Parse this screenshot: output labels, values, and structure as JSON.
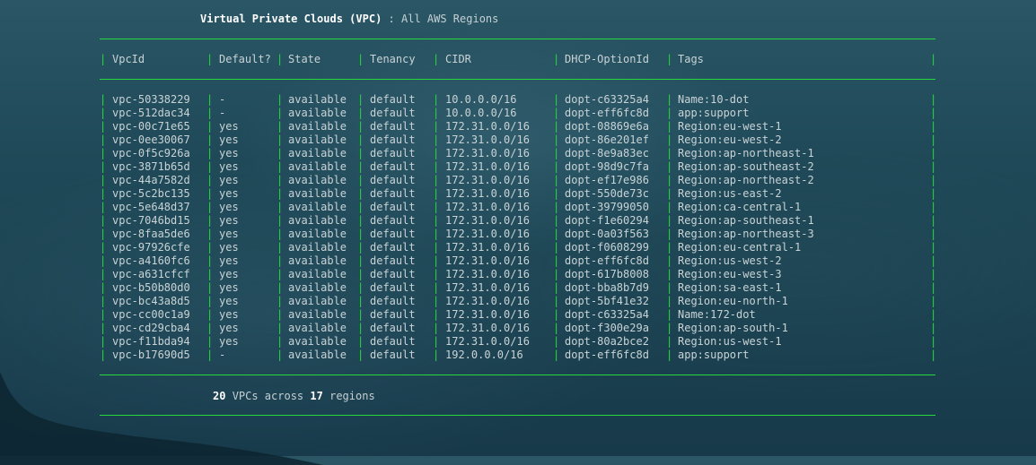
{
  "header": {
    "title": "Virtual Private Clouds (VPC)",
    "separator": ":",
    "subtitle": "All AWS Regions"
  },
  "colors": {
    "border": "#27d83b",
    "text": "#c9d3d6",
    "background": "#1f4958"
  },
  "table": {
    "columns": [
      "VpcId",
      "Default?",
      "State",
      "Tenancy",
      "CIDR",
      "DHCP-OptionId",
      "Tags"
    ],
    "rows": [
      [
        "vpc-50338229",
        "-",
        "available",
        "default",
        "10.0.0.0/16",
        "dopt-c63325a4",
        "Name:10-dot"
      ],
      [
        "vpc-512dac34",
        "-",
        "available",
        "default",
        "10.0.0.0/16",
        "dopt-eff6fc8d",
        "app:support"
      ],
      [
        "vpc-00c71e65",
        "yes",
        "available",
        "default",
        "172.31.0.0/16",
        "dopt-08869e6a",
        "Region:eu-west-1"
      ],
      [
        "vpc-0ee30067",
        "yes",
        "available",
        "default",
        "172.31.0.0/16",
        "dopt-86e201ef",
        "Region:eu-west-2"
      ],
      [
        "vpc-0f5c926a",
        "yes",
        "available",
        "default",
        "172.31.0.0/16",
        "dopt-8e9a83ec",
        "Region:ap-northeast-1"
      ],
      [
        "vpc-3871b65d",
        "yes",
        "available",
        "default",
        "172.31.0.0/16",
        "dopt-98d9c7fa",
        "Region:ap-southeast-2"
      ],
      [
        "vpc-44a7582d",
        "yes",
        "available",
        "default",
        "172.31.0.0/16",
        "dopt-ef17e986",
        "Region:ap-northeast-2"
      ],
      [
        "vpc-5c2bc135",
        "yes",
        "available",
        "default",
        "172.31.0.0/16",
        "dopt-550de73c",
        "Region:us-east-2"
      ],
      [
        "vpc-5e648d37",
        "yes",
        "available",
        "default",
        "172.31.0.0/16",
        "dopt-39799050",
        "Region:ca-central-1"
      ],
      [
        "vpc-7046bd15",
        "yes",
        "available",
        "default",
        "172.31.0.0/16",
        "dopt-f1e60294",
        "Region:ap-southeast-1"
      ],
      [
        "vpc-8faa5de6",
        "yes",
        "available",
        "default",
        "172.31.0.0/16",
        "dopt-0a03f563",
        "Region:ap-northeast-3"
      ],
      [
        "vpc-97926cfe",
        "yes",
        "available",
        "default",
        "172.31.0.0/16",
        "dopt-f0608299",
        "Region:eu-central-1"
      ],
      [
        "vpc-a4160fc6",
        "yes",
        "available",
        "default",
        "172.31.0.0/16",
        "dopt-eff6fc8d",
        "Region:us-west-2"
      ],
      [
        "vpc-a631cfcf",
        "yes",
        "available",
        "default",
        "172.31.0.0/16",
        "dopt-617b8008",
        "Region:eu-west-3"
      ],
      [
        "vpc-b50b80d0",
        "yes",
        "available",
        "default",
        "172.31.0.0/16",
        "dopt-bba8b7d9",
        "Region:sa-east-1"
      ],
      [
        "vpc-bc43a8d5",
        "yes",
        "available",
        "default",
        "172.31.0.0/16",
        "dopt-5bf41e32",
        "Region:eu-north-1"
      ],
      [
        "vpc-cc00c1a9",
        "yes",
        "available",
        "default",
        "172.31.0.0/16",
        "dopt-c63325a4",
        "Name:172-dot"
      ],
      [
        "vpc-cd29cba4",
        "yes",
        "available",
        "default",
        "172.31.0.0/16",
        "dopt-f300e29a",
        "Region:ap-south-1"
      ],
      [
        "vpc-f11bda94",
        "yes",
        "available",
        "default",
        "172.31.0.0/16",
        "dopt-80a2bce2",
        "Region:us-west-1"
      ],
      [
        "vpc-b17690d5",
        "-",
        "available",
        "default",
        "192.0.0.0/16",
        "dopt-eff6fc8d",
        "app:support"
      ]
    ]
  },
  "footer": {
    "vpc_count": "20",
    "text_middle": "VPCs across",
    "region_count": "17",
    "text_end": "regions"
  }
}
